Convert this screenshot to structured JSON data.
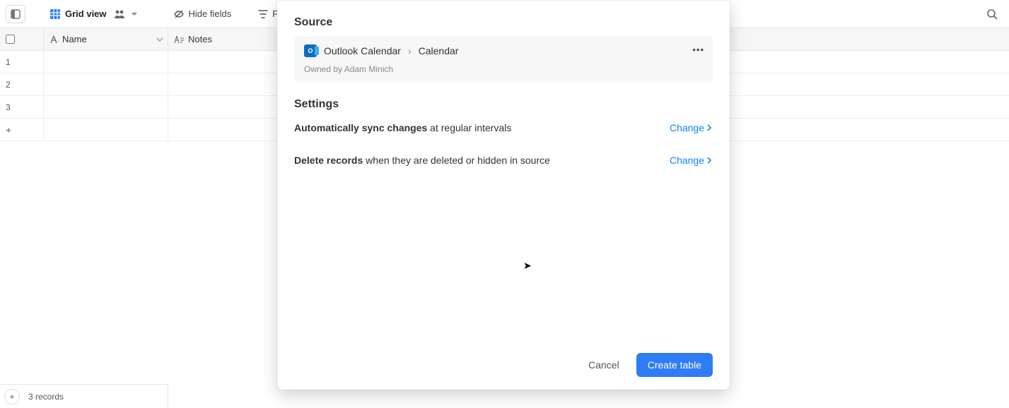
{
  "toolbar": {
    "view_name": "Grid view",
    "hide_fields": "Hide fields",
    "filter": "Filter"
  },
  "columns": {
    "name": "Name",
    "notes": "Notes"
  },
  "rows": [
    "1",
    "2",
    "3"
  ],
  "footer": {
    "record_count": "3 records"
  },
  "modal": {
    "source_title": "Source",
    "source_app": "Outlook Calendar",
    "source_item": "Calendar",
    "owned_by": "Owned by Adam Minich",
    "settings_title": "Settings",
    "setting1_bold": "Automatically sync changes",
    "setting1_rest": " at regular intervals",
    "setting2_bold": "Delete records",
    "setting2_rest": " when they are deleted or hidden in source",
    "change": "Change",
    "cancel": "Cancel",
    "create": "Create table"
  }
}
